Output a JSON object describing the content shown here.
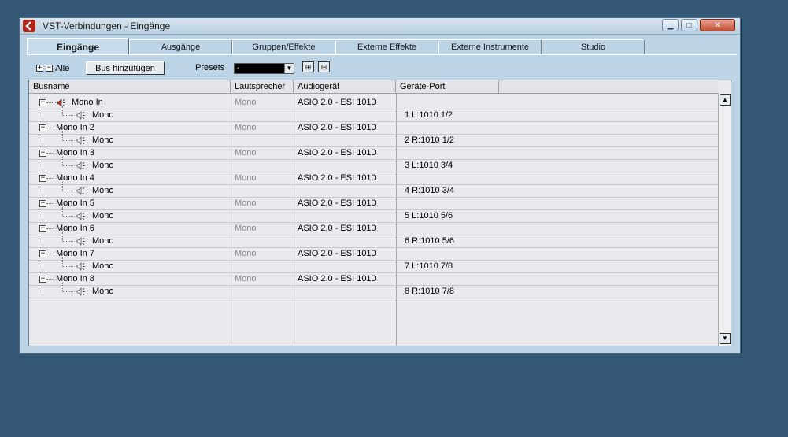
{
  "window": {
    "title": "VST-Verbindungen - Eingänge"
  },
  "tabs": [
    {
      "label": "Eingänge",
      "active": true
    },
    {
      "label": "Ausgänge"
    },
    {
      "label": "Gruppen/Effekte"
    },
    {
      "label": "Externe Effekte"
    },
    {
      "label": "Externe Instrumente"
    },
    {
      "label": "Studio"
    }
  ],
  "toolbar": {
    "expand_all_icon": "plus-box-icon",
    "collapse_all_icon": "minus-box-icon",
    "all_label": "Alle",
    "add_bus_label": "Bus hinzufügen",
    "presets_label": "Presets",
    "presets_value": "-",
    "save_preset_icon": "save-preset-icon",
    "delete_preset_icon": "delete-preset-icon"
  },
  "table": {
    "columns": [
      "Busname",
      "Lautsprecher",
      "Audiogerät",
      "Geräte-Port"
    ],
    "rows": [
      {
        "bus": "Mono In",
        "speaker": "Mono",
        "device": "ASIO 2.0 - ESI 1010",
        "channel": "Mono",
        "port": "1 L:1010 1/2",
        "active": true
      },
      {
        "bus": "Mono In 2",
        "speaker": "Mono",
        "device": "ASIO 2.0 - ESI 1010",
        "channel": "Mono",
        "port": "2 R:1010 1/2"
      },
      {
        "bus": "Mono In 3",
        "speaker": "Mono",
        "device": "ASIO 2.0 - ESI 1010",
        "channel": "Mono",
        "port": "3 L:1010 3/4"
      },
      {
        "bus": "Mono In 4",
        "speaker": "Mono",
        "device": "ASIO 2.0 - ESI 1010",
        "channel": "Mono",
        "port": "4 R:1010 3/4"
      },
      {
        "bus": "Mono In 5",
        "speaker": "Mono",
        "device": "ASIO 2.0 - ESI 1010",
        "channel": "Mono",
        "port": "5 L:1010 5/6"
      },
      {
        "bus": "Mono In 6",
        "speaker": "Mono",
        "device": "ASIO 2.0 - ESI 1010",
        "channel": "Mono",
        "port": "6 R:1010 5/6"
      },
      {
        "bus": "Mono In 7",
        "speaker": "Mono",
        "device": "ASIO 2.0 - ESI 1010",
        "channel": "Mono",
        "port": "7 L:1010 7/8"
      },
      {
        "bus": "Mono In 8",
        "speaker": "Mono",
        "device": "ASIO 2.0 - ESI 1010",
        "channel": "Mono",
        "port": "8 R:1010 7/8"
      }
    ]
  },
  "colors": {
    "background": "#335775",
    "window": "#bdd3e6",
    "grid": "#eaeaee",
    "active_speaker": "#c0392b"
  }
}
